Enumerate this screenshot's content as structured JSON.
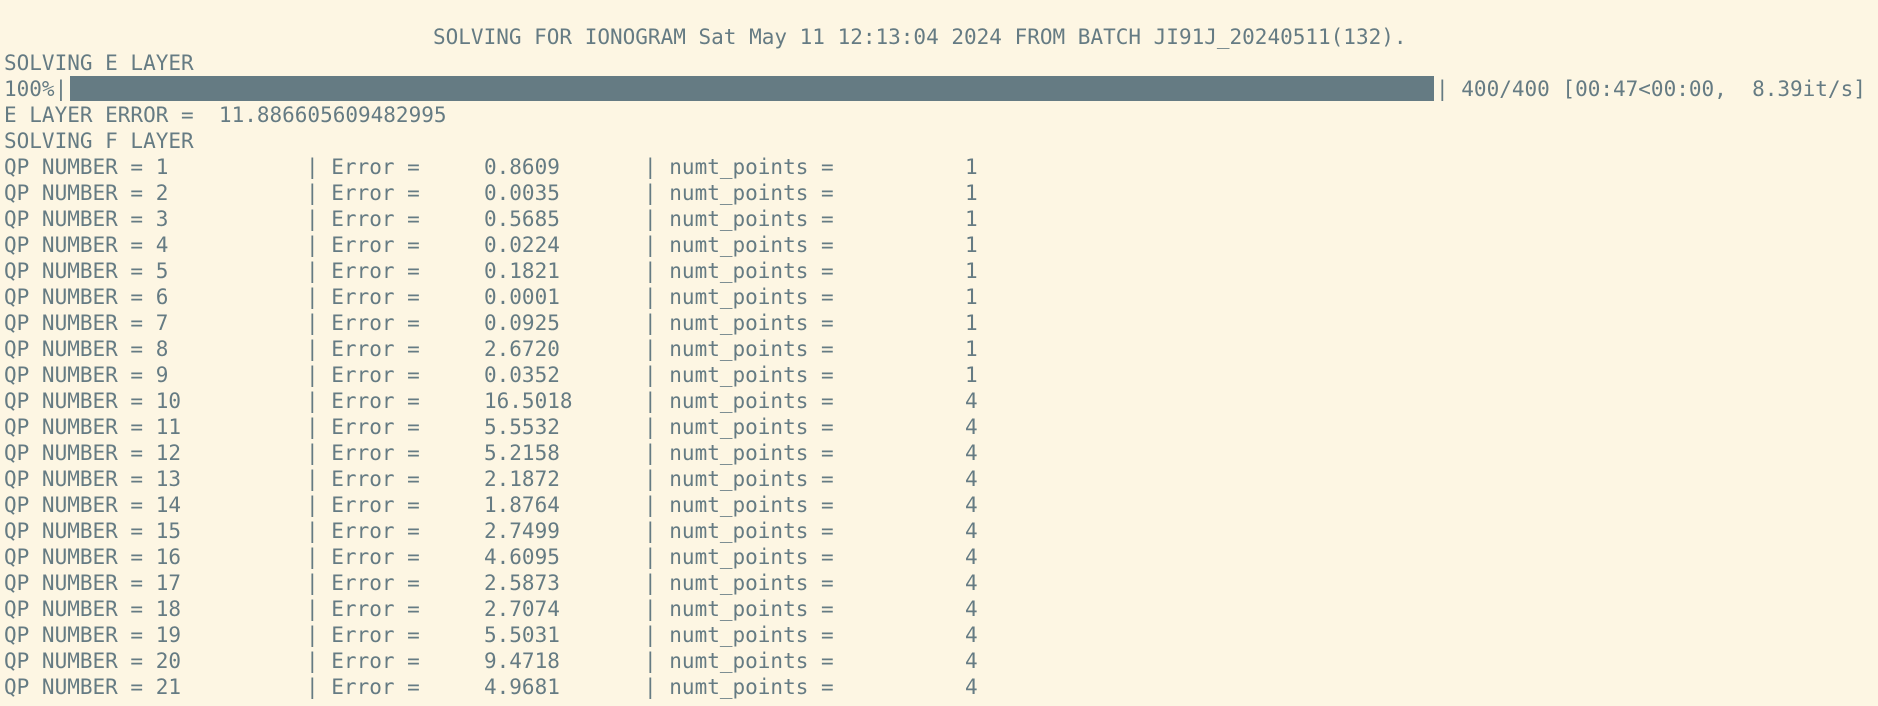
{
  "header": "SOLVING FOR IONOGRAM Sat May 11 12:13:04 2024 FROM BATCH JI91J_20240511(132).",
  "e_layer_title": "SOLVING E LAYER",
  "progress": {
    "percent_label": "100%|",
    "fraction": 1.0,
    "status": "| 400/400 [00:47<00:00,  8.39it/s]",
    "bar_color": "#657b83"
  },
  "e_layer_error": "E LAYER ERROR =  11.886605609482995",
  "f_layer_title": "SOLVING F LAYER",
  "qp_labels": {
    "error_label": "| Error =",
    "points_label": "| numt_points ="
  },
  "qp_rows": [
    {
      "qp": "QP NUMBER = 1",
      "error": "0.8609",
      "points": "1"
    },
    {
      "qp": "QP NUMBER = 2",
      "error": "0.0035",
      "points": "1"
    },
    {
      "qp": "QP NUMBER = 3",
      "error": "0.5685",
      "points": "1"
    },
    {
      "qp": "QP NUMBER = 4",
      "error": "0.0224",
      "points": "1"
    },
    {
      "qp": "QP NUMBER = 5",
      "error": "0.1821",
      "points": "1"
    },
    {
      "qp": "QP NUMBER = 6",
      "error": "0.0001",
      "points": "1"
    },
    {
      "qp": "QP NUMBER = 7",
      "error": "0.0925",
      "points": "1"
    },
    {
      "qp": "QP NUMBER = 8",
      "error": "2.6720",
      "points": "1"
    },
    {
      "qp": "QP NUMBER = 9",
      "error": "0.0352",
      "points": "1"
    },
    {
      "qp": "QP NUMBER = 10",
      "error": "16.5018",
      "points": "4"
    },
    {
      "qp": "QP NUMBER = 11",
      "error": "5.5532",
      "points": "4"
    },
    {
      "qp": "QP NUMBER = 12",
      "error": "5.2158",
      "points": "4"
    },
    {
      "qp": "QP NUMBER = 13",
      "error": "2.1872",
      "points": "4"
    },
    {
      "qp": "QP NUMBER = 14",
      "error": "1.8764",
      "points": "4"
    },
    {
      "qp": "QP NUMBER = 15",
      "error": "2.7499",
      "points": "4"
    },
    {
      "qp": "QP NUMBER = 16",
      "error": "4.6095",
      "points": "4"
    },
    {
      "qp": "QP NUMBER = 17",
      "error": "2.5873",
      "points": "4"
    },
    {
      "qp": "QP NUMBER = 18",
      "error": "2.7074",
      "points": "4"
    },
    {
      "qp": "QP NUMBER = 19",
      "error": "5.5031",
      "points": "4"
    },
    {
      "qp": "QP NUMBER = 20",
      "error": "9.4718",
      "points": "4"
    },
    {
      "qp": "QP NUMBER = 21",
      "error": "4.9681",
      "points": "4"
    }
  ],
  "colors": {
    "background": "#fdf6e3",
    "foreground": "#657b83"
  }
}
